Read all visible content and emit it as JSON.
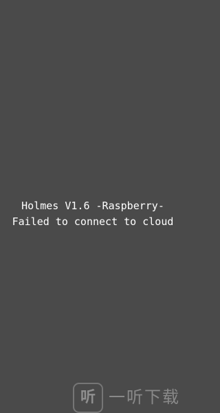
{
  "status": {
    "title_line": "Holmes V1.6 -Raspberry-",
    "message_line": "Failed to connect to cloud"
  },
  "watermark": {
    "logo_glyph": "听",
    "text": "一听下载"
  },
  "colors": {
    "background": "#4a4a4a",
    "text": "#ffffff"
  }
}
